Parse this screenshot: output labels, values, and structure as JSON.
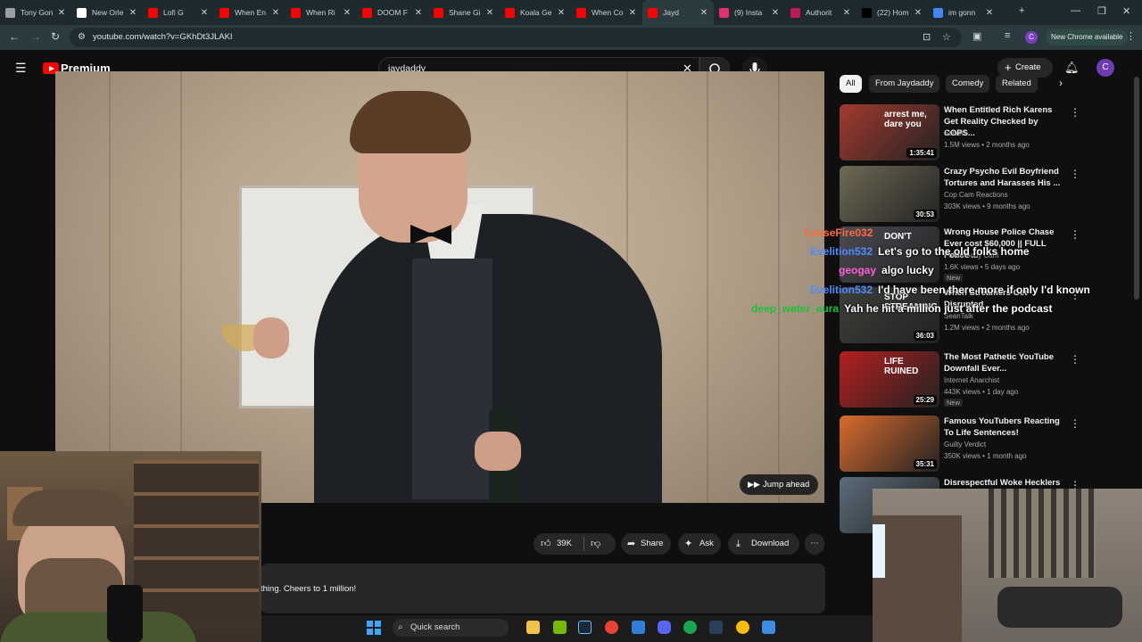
{
  "browser": {
    "tabs": [
      {
        "label": "Tony Gon",
        "color": "#9aa0a6"
      },
      {
        "label": "New Orle",
        "color": "#ffffff"
      },
      {
        "label": "Lofi G",
        "color": "#ff0000"
      },
      {
        "label": "When En",
        "color": "#ff0000"
      },
      {
        "label": "When Ri",
        "color": "#ff0000"
      },
      {
        "label": "DOOM F",
        "color": "#ff0000"
      },
      {
        "label": "Shane Gi",
        "color": "#ff0000"
      },
      {
        "label": "Koala Ge",
        "color": "#ff0000"
      },
      {
        "label": "When Co",
        "color": "#ff0000"
      },
      {
        "label": "Jayd",
        "color": "#ff0000"
      },
      {
        "label": "(9) Insta",
        "color": "#e1306c"
      },
      {
        "label": "Authorit",
        "color": "#c2185b"
      },
      {
        "label": "(22) Hom",
        "color": "#000000"
      },
      {
        "label": "im gonn",
        "color": "#4285f4"
      }
    ],
    "active_tab_index": 9,
    "url": "youtube.com/watch?v=GKhDt3JLAKI",
    "new_chrome_available": "New Chrome available",
    "profile_letter": "C"
  },
  "youtube": {
    "logo_text": "Premium",
    "search_value": "jaydaddy",
    "create_label": "Create",
    "avatar_letter": "C",
    "jump_ahead_label": "Jump ahead",
    "actions": {
      "likes": "39K",
      "share": "Share",
      "ask": "Ask",
      "download": "Download"
    },
    "description_snippet": "thing. Cheers to 1 million!",
    "chips": [
      "All",
      "From Jaydaddy",
      "Comedy",
      "Related"
    ],
    "recommendations": [
      {
        "title": "When Entitled Rich Karens Get Reality Checked by COPS...",
        "channel": "Solved",
        "meta": "1.5M views • 2 months ago",
        "duration": "1:35:41",
        "badge": "",
        "thumb_color": "#a33a2e",
        "thumb_text": "arrest me, dare you"
      },
      {
        "title": "Crazy Psycho Evil Boyfriend Tortures and Harasses His ...",
        "channel": "Cop Cam Reactions",
        "meta": "303K views • 9 months ago",
        "duration": "30:53",
        "badge": "",
        "thumb_color": "#6f6a55",
        "thumb_text": ""
      },
      {
        "title": "Wrong House Police Chase Ever cost $60,000 || FULL Police ...",
        "channel": "Police Body Cam",
        "meta": "1.6K views • 5 days ago",
        "duration": "",
        "badge": "New",
        "thumb_color": "#4b4a52",
        "thumb_text": "DON'T"
      },
      {
        "title": "When Streamers Get Disrupted",
        "channel": "SeanTalk",
        "meta": "1.2M views • 2 months ago",
        "duration": "36:03",
        "badge": "",
        "thumb_color": "#3c3f3a",
        "thumb_text": "STOP STREAMING"
      },
      {
        "title": "The Most Pathetic YouTube Downfall Ever...",
        "channel": "Internet Anarchist",
        "meta": "443K views • 1 day ago",
        "duration": "25:29",
        "badge": "New",
        "thumb_color": "#b51f1f",
        "thumb_text": "LIFE RUINED"
      },
      {
        "title": "Famous YouTubers Reacting To Life Sentences!",
        "channel": "Guilty Verdict",
        "meta": "350K views • 1 month ago",
        "duration": "35:31",
        "badge": "",
        "thumb_color": "#d96b2c",
        "thumb_text": ""
      },
      {
        "title": "Disrespectful Woke Hecklers",
        "channel": "",
        "meta": "",
        "duration": "",
        "badge": "",
        "thumb_color": "#5b6c7a",
        "thumb_text": ""
      }
    ]
  },
  "chat": [
    {
      "user": "CeaseFire032",
      "message": "",
      "color": "#ff6a3d"
    },
    {
      "user": "Evelition532",
      "message": "Let's go to the old folks home",
      "color": "#4f8cff"
    },
    {
      "user": "geogay",
      "message": "algo lucky",
      "color": "#ff5fd2"
    },
    {
      "user": "Evelition532",
      "message": "I'd have been there more if only I'd known",
      "color": "#4f8cff"
    },
    {
      "user": "deep_water_aura",
      "message": "Yah he hit a million just after the podcast",
      "color": "#1fbf3a"
    }
  ],
  "taskbar": {
    "quick_search": "Quick search"
  }
}
